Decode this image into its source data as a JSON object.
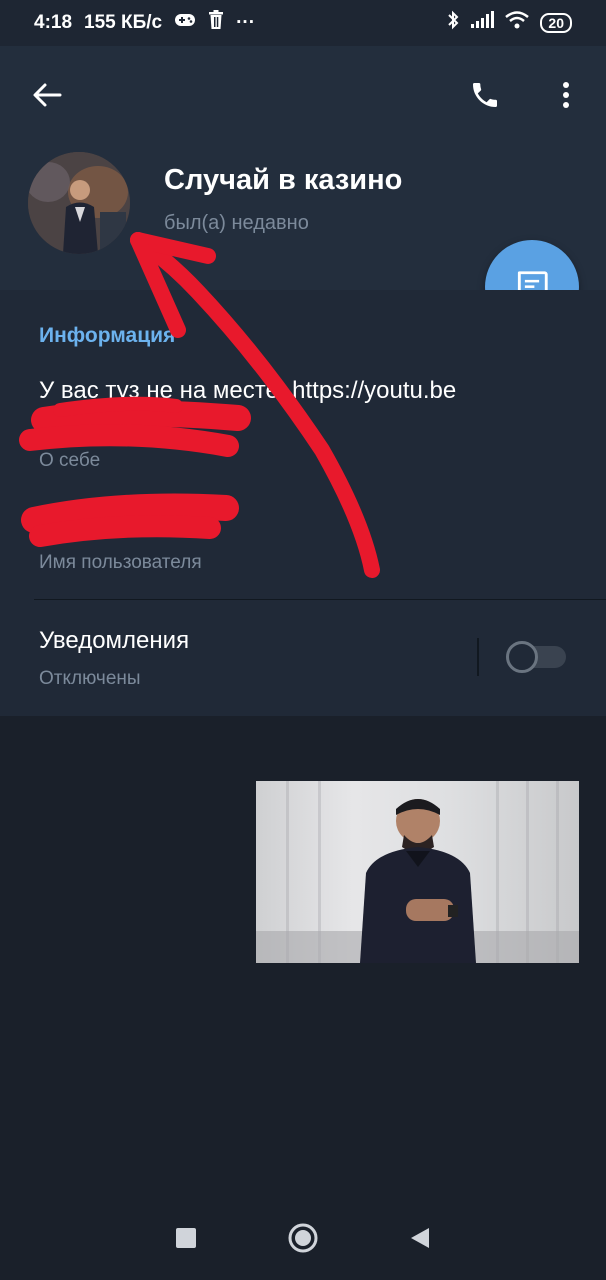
{
  "status_bar": {
    "time": "4:18",
    "speed": "155 КБ/с",
    "more": "···",
    "battery": "20"
  },
  "header": {
    "title": "Случай в казино",
    "subtitle": "был(а) недавно"
  },
  "info": {
    "section_title": "Информация",
    "bio_line1": "У вас туз не на месте. https://youtu.be",
    "bio_line2": "/",
    "bio_label": "О себе",
    "username_label": "Имя пользователя",
    "notifications_label": "Уведомления",
    "notifications_status": "Отключены",
    "notifications_enabled": false
  },
  "colors": {
    "accent": "#6cb2ee",
    "fab": "#5aa1e3",
    "annotation": "#e8192c",
    "background": "#1a202a"
  },
  "icons": {
    "back": "arrow-left-icon",
    "call": "phone-icon",
    "menu": "more-vertical-icon",
    "fab": "message-icon"
  }
}
